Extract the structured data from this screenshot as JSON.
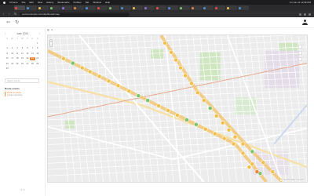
{
  "menubar": {
    "items": [
      "Chrome",
      "File",
      "Edit",
      "View",
      "History",
      "Bookmarks",
      "Profiles",
      "Tab",
      "Window",
      "Help"
    ],
    "clock": "Fri Jun 21 12:36 PM"
  },
  "browser": {
    "url": "portal.example.com/dashboard/map"
  },
  "calendar": {
    "month_label": "June 2024",
    "weekdays": [
      "S",
      "M",
      "T",
      "W",
      "T",
      "F",
      "S"
    ],
    "days": [
      "",
      "",
      "",
      "",
      "",
      "",
      "1",
      "2",
      "3",
      "4",
      "5",
      "6",
      "7",
      "8",
      "9",
      "10",
      "11",
      "12",
      "13",
      "14",
      "15",
      "16",
      "17",
      "18",
      "19",
      "20",
      "21",
      "22",
      "23",
      "24",
      "25",
      "26",
      "27",
      "28",
      "29",
      "30"
    ],
    "selected_day": "21"
  },
  "sidebar": {
    "search_placeholder": "Search events",
    "section_title": "Route events",
    "events": [
      {
        "title": "Route 12 active",
        "subtitle": "3 stops reporting"
      }
    ],
    "footer": "v2.4.1"
  },
  "map": {
    "copyright": "© OpenStreetMap contributors",
    "colors": {
      "route_main": "#f2c46b",
      "marker_yellow": "#f0c04a",
      "marker_green": "#7cc36d",
      "marker_orange": "#e8873a"
    }
  }
}
